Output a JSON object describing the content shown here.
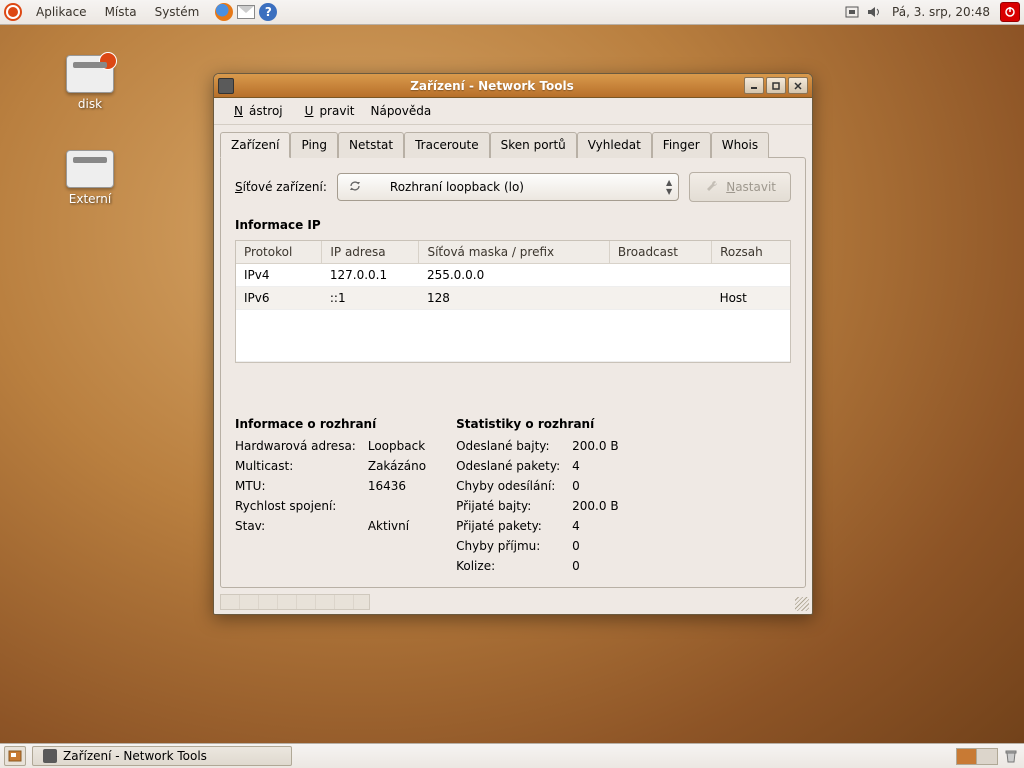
{
  "top_panel": {
    "menus": [
      "Aplikace",
      "Místa",
      "Systém"
    ],
    "clock": "Pá,  3. srp, 20:48"
  },
  "desktop": {
    "icons": [
      {
        "label": "disk"
      },
      {
        "label": "Externí"
      }
    ]
  },
  "window": {
    "title": "Zařízení - Network Tools",
    "menus": [
      {
        "label": "Nástroj",
        "underline": 0
      },
      {
        "label": "Upravit",
        "underline": 0
      },
      {
        "label": "Nápověda",
        "underline": -1
      }
    ],
    "tabs": [
      "Zařízení",
      "Ping",
      "Netstat",
      "Traceroute",
      "Sken portů",
      "Vyhledat",
      "Finger",
      "Whois"
    ],
    "active_tab": 0,
    "device_label": "Síťové zařízení:",
    "device_combo": "Rozhraní loopback (lo)",
    "config_btn": "Nastavit",
    "ip_section": "Informace IP",
    "ip_headers": [
      "Protokol",
      "IP adresa",
      "Síťová maska / prefix",
      "Broadcast",
      "Rozsah"
    ],
    "ip_rows": [
      {
        "proto": "IPv4",
        "addr": "127.0.0.1",
        "mask": "255.0.0.0",
        "bcast": "",
        "scope": ""
      },
      {
        "proto": "IPv6",
        "addr": "::1",
        "mask": "128",
        "bcast": "",
        "scope": "Host"
      }
    ],
    "iface_section": "Informace o rozhraní",
    "iface_info": [
      {
        "k": "Hardwarová adresa:",
        "v": "Loopback"
      },
      {
        "k": "Multicast:",
        "v": "Zakázáno"
      },
      {
        "k": "MTU:",
        "v": "16436"
      },
      {
        "k": "Rychlost spojení:",
        "v": ""
      },
      {
        "k": "Stav:",
        "v": "Aktivní"
      }
    ],
    "stats_section": "Statistiky o rozhraní",
    "stats": [
      {
        "k": "Odeslané bajty:",
        "v": "200.0 B"
      },
      {
        "k": "Odeslané pakety:",
        "v": "4"
      },
      {
        "k": "Chyby odesílání:",
        "v": "0"
      },
      {
        "k": "Přijaté bajty:",
        "v": "200.0 B"
      },
      {
        "k": "Přijaté pakety:",
        "v": "4"
      },
      {
        "k": "Chyby příjmu:",
        "v": "0"
      },
      {
        "k": "Kolize:",
        "v": "0"
      }
    ]
  },
  "bottom_panel": {
    "task": "Zařízení - Network Tools"
  }
}
